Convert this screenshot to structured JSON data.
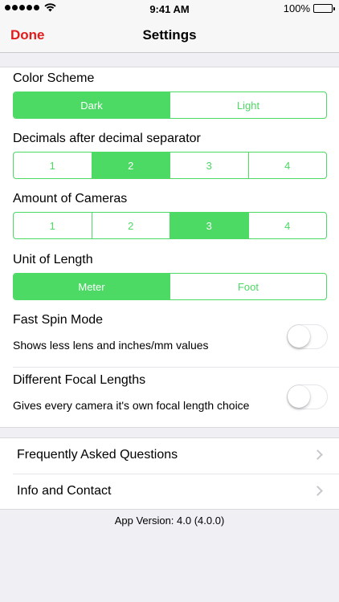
{
  "status_bar": {
    "time": "9:41 AM",
    "battery_text": "100%",
    "battery_level": 1.0
  },
  "nav": {
    "done_label": "Done",
    "title": "Settings"
  },
  "settings": {
    "color_scheme": {
      "label": "Color Scheme",
      "options": [
        "Dark",
        "Light"
      ],
      "selected": "Dark"
    },
    "decimals": {
      "label": "Decimals after decimal separator",
      "options": [
        "1",
        "2",
        "3",
        "4"
      ],
      "selected": "2"
    },
    "cameras": {
      "label": "Amount of Cameras",
      "options": [
        "1",
        "2",
        "3",
        "4"
      ],
      "selected": "3"
    },
    "unit": {
      "label": "Unit of Length",
      "options": [
        "Meter",
        "Foot"
      ],
      "selected": "Meter"
    },
    "fast_spin": {
      "label": "Fast Spin Mode",
      "description": "Shows less lens and inches/mm values",
      "enabled": false
    },
    "focal_lengths": {
      "label": "Different Focal Lengths",
      "description": "Gives every camera it's own focal length choice",
      "enabled": false
    }
  },
  "links": {
    "faq_label": "Frequently Asked Questions",
    "info_label": "Info and Contact"
  },
  "version_text": "App Version: 4.0 (4.0.0)",
  "colors": {
    "accent_green": "#4cd964",
    "done_red": "#e21b1b",
    "background": "#efeff4"
  },
  "icons": {
    "signal": "signal-dots-icon",
    "wifi": "wifi-icon",
    "battery": "battery-icon",
    "chevron": "chevron-right-icon"
  }
}
